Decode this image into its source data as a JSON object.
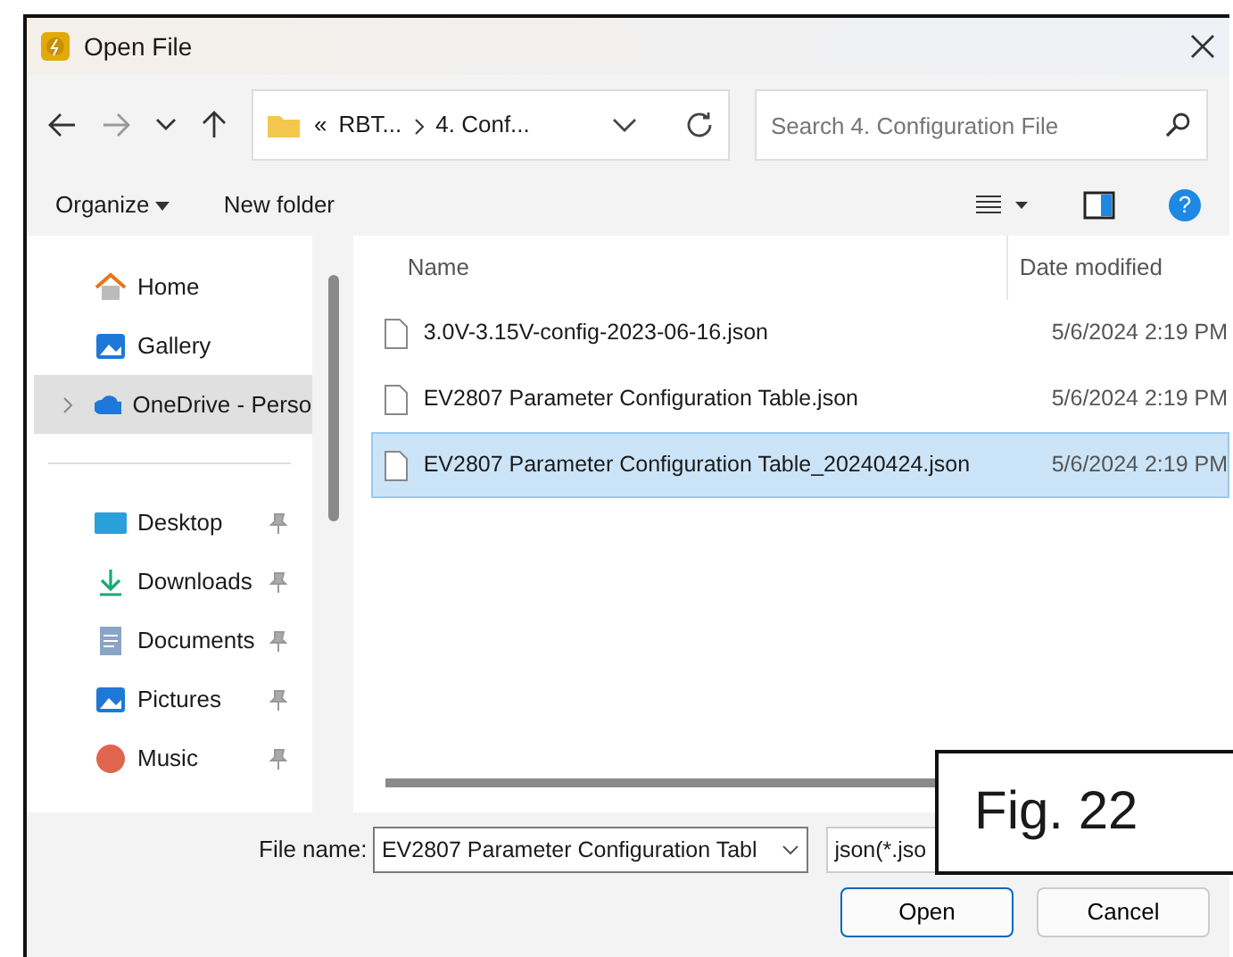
{
  "window": {
    "title": "Open File"
  },
  "address": {
    "crumbs": [
      "«",
      "RBT...",
      "4. Conf..."
    ]
  },
  "search": {
    "placeholder": "Search 4. Configuration File"
  },
  "toolbar": {
    "organize": "Organize",
    "new_folder": "New folder",
    "help": "?"
  },
  "sidebar": {
    "items": [
      {
        "label": "Home",
        "kind": "home",
        "selected": false,
        "pinned": false,
        "expandable": false
      },
      {
        "label": "Gallery",
        "kind": "gallery",
        "selected": false,
        "pinned": false,
        "expandable": false
      },
      {
        "label": "OneDrive - Perso",
        "kind": "cloud",
        "selected": true,
        "pinned": false,
        "expandable": true
      },
      {
        "kind": "divider"
      },
      {
        "label": "Desktop",
        "kind": "desktop",
        "selected": false,
        "pinned": true,
        "expandable": false
      },
      {
        "label": "Downloads",
        "kind": "download",
        "selected": false,
        "pinned": true,
        "expandable": false
      },
      {
        "label": "Documents",
        "kind": "document",
        "selected": false,
        "pinned": true,
        "expandable": false
      },
      {
        "label": "Pictures",
        "kind": "gallery",
        "selected": false,
        "pinned": true,
        "expandable": false
      },
      {
        "label": "Music",
        "kind": "music",
        "selected": false,
        "pinned": true,
        "expandable": false
      }
    ]
  },
  "table": {
    "columns": [
      "Name",
      "Date modified"
    ],
    "rows": [
      {
        "name": "3.0V-3.15V-config-2023-06-16.json",
        "date": "5/6/2024 2:19 PM",
        "selected": false
      },
      {
        "name": "EV2807 Parameter Configuration Table.json",
        "date": "5/6/2024 2:19 PM",
        "selected": false
      },
      {
        "name": "EV2807 Parameter Configuration Table_20240424.json",
        "date": "5/6/2024 2:19 PM",
        "selected": true
      }
    ]
  },
  "footer": {
    "file_name_label": "File name:",
    "file_name": "EV2807 Parameter Configuration Tabl",
    "file_type": "json(*.jso",
    "buttons": [
      "Open",
      "Cancel"
    ]
  },
  "caption": "Fig. 22"
}
